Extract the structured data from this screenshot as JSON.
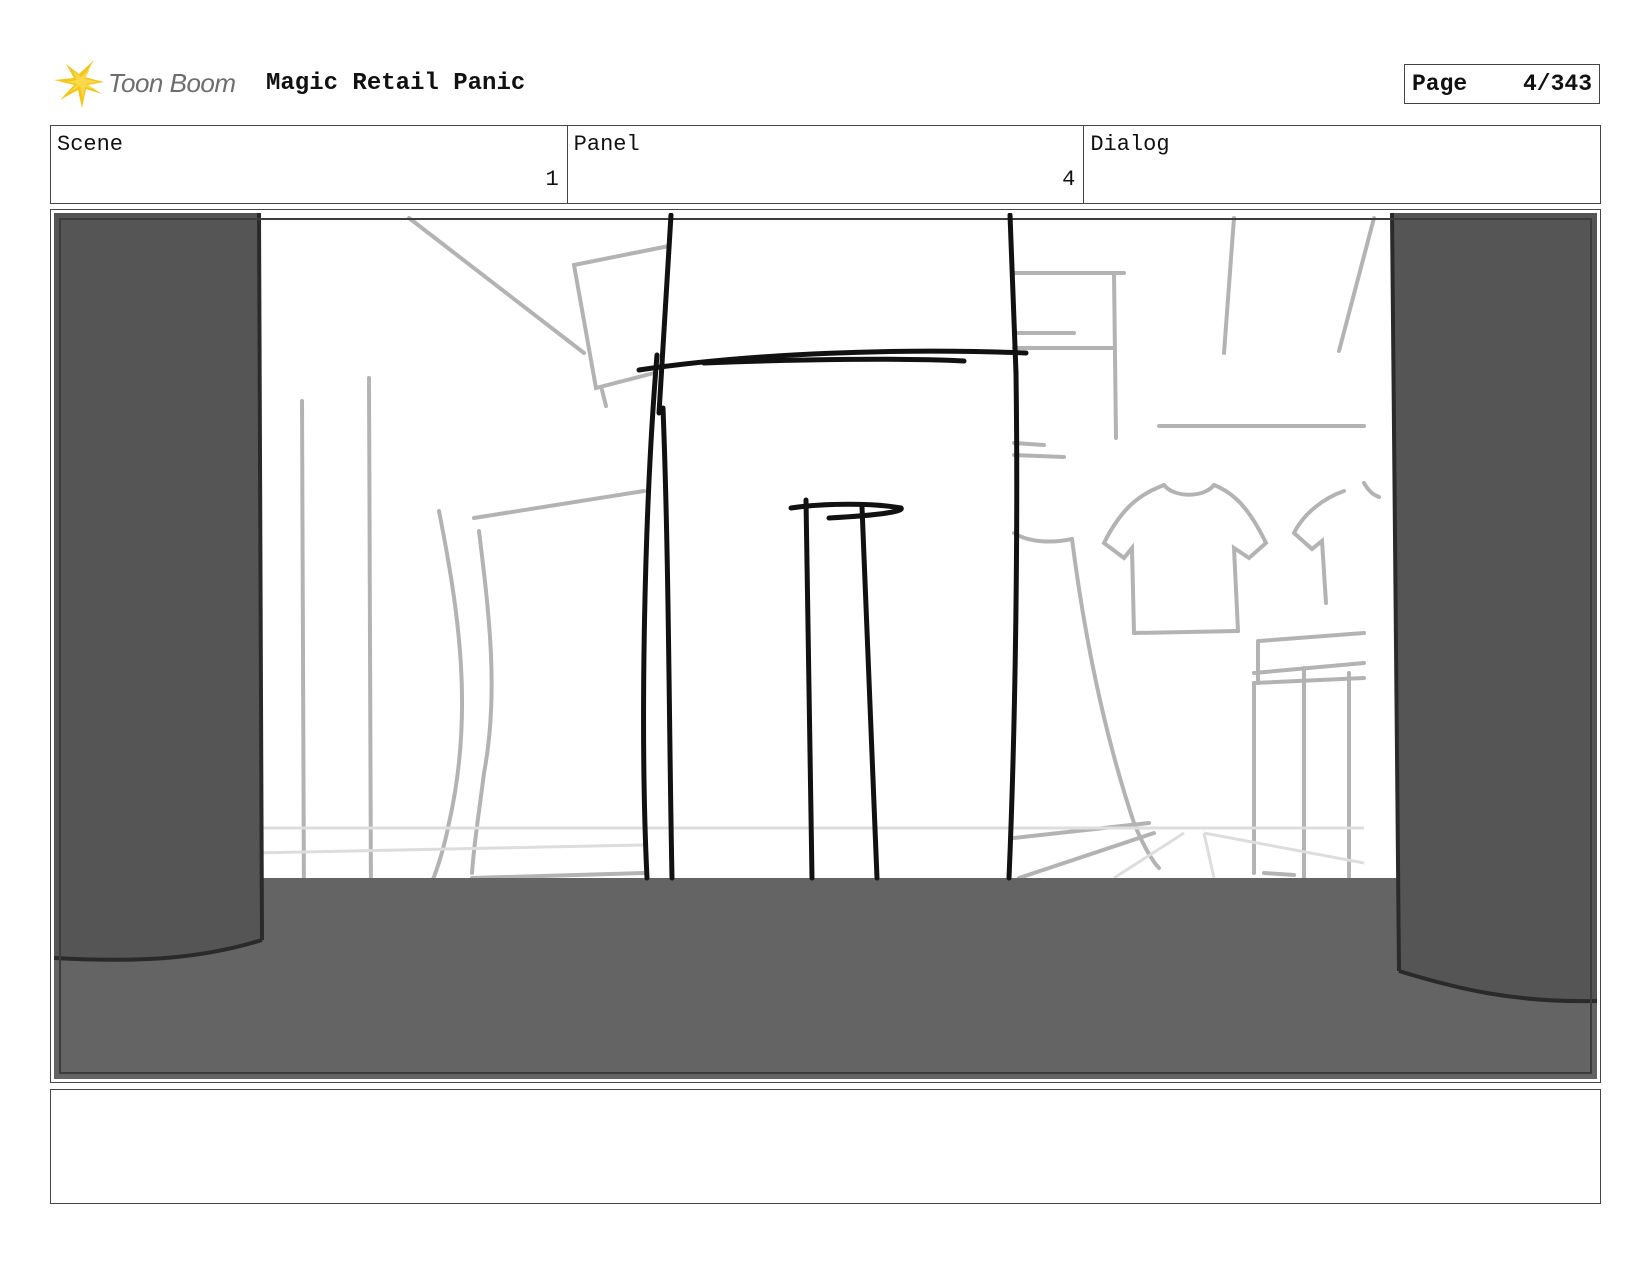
{
  "header": {
    "logo_text": "Toon Boom",
    "project_title": "Magic Retail Panic",
    "page_label": "Page",
    "page_number": "4/343"
  },
  "info": {
    "scene_label": "Scene",
    "scene_value": "1",
    "panel_label": "Panel",
    "panel_value": "4",
    "dialog_label": "Dialog",
    "dialog_value": ""
  },
  "notes": {
    "text": ""
  },
  "colors": {
    "logo_star": "#f5c518",
    "frame_dark": "#555555",
    "floor_dark": "#646464",
    "sketch_grey": "#b3b3b3"
  }
}
